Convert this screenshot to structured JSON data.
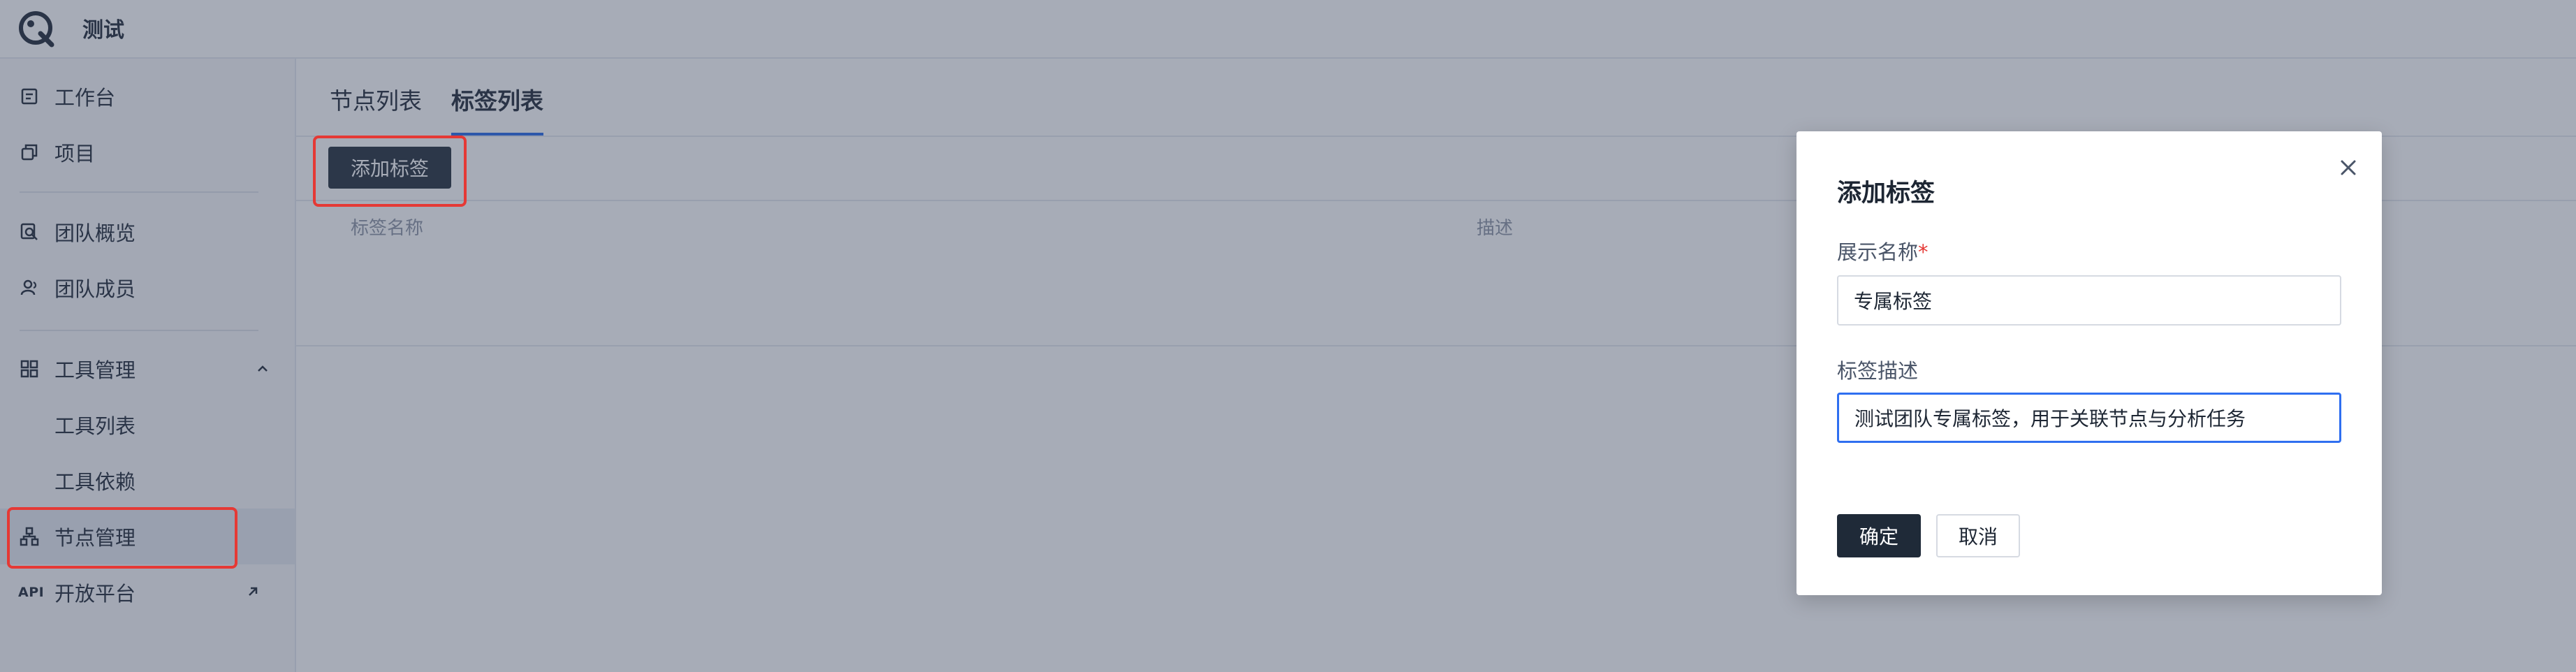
{
  "app": {
    "title": "测试"
  },
  "sidebar": {
    "items": [
      {
        "label": "工作台",
        "icon": "workbench-icon"
      },
      {
        "label": "项目",
        "icon": "project-icon"
      },
      {
        "label": "团队概览",
        "icon": "team-overview-icon"
      },
      {
        "label": "团队成员",
        "icon": "team-member-icon"
      },
      {
        "label": "工具管理",
        "icon": "tool-grid-icon",
        "expanded": true
      },
      {
        "label": "工具列表"
      },
      {
        "label": "工具依赖"
      },
      {
        "label": "节点管理",
        "icon": "node-icon",
        "active": true
      },
      {
        "label": "开放平台",
        "icon_text": "API"
      }
    ]
  },
  "main": {
    "tabs": [
      {
        "label": "节点列表"
      },
      {
        "label": "标签列表",
        "active": true
      }
    ],
    "add_button": "添加标签",
    "table": {
      "columns": [
        "标签名称",
        "描述"
      ]
    }
  },
  "modal": {
    "title": "添加标签",
    "name_label": "展示名称",
    "required_mark": "*",
    "name_value": "专属标签",
    "desc_label": "标签描述",
    "desc_value": "测试团队专属标签，用于关联节点与分析任务",
    "confirm": "确定",
    "cancel": "取消"
  },
  "colors": {
    "accent": "#2166e8",
    "primary_button": "#1f2a38",
    "highlight": "#e53935"
  }
}
